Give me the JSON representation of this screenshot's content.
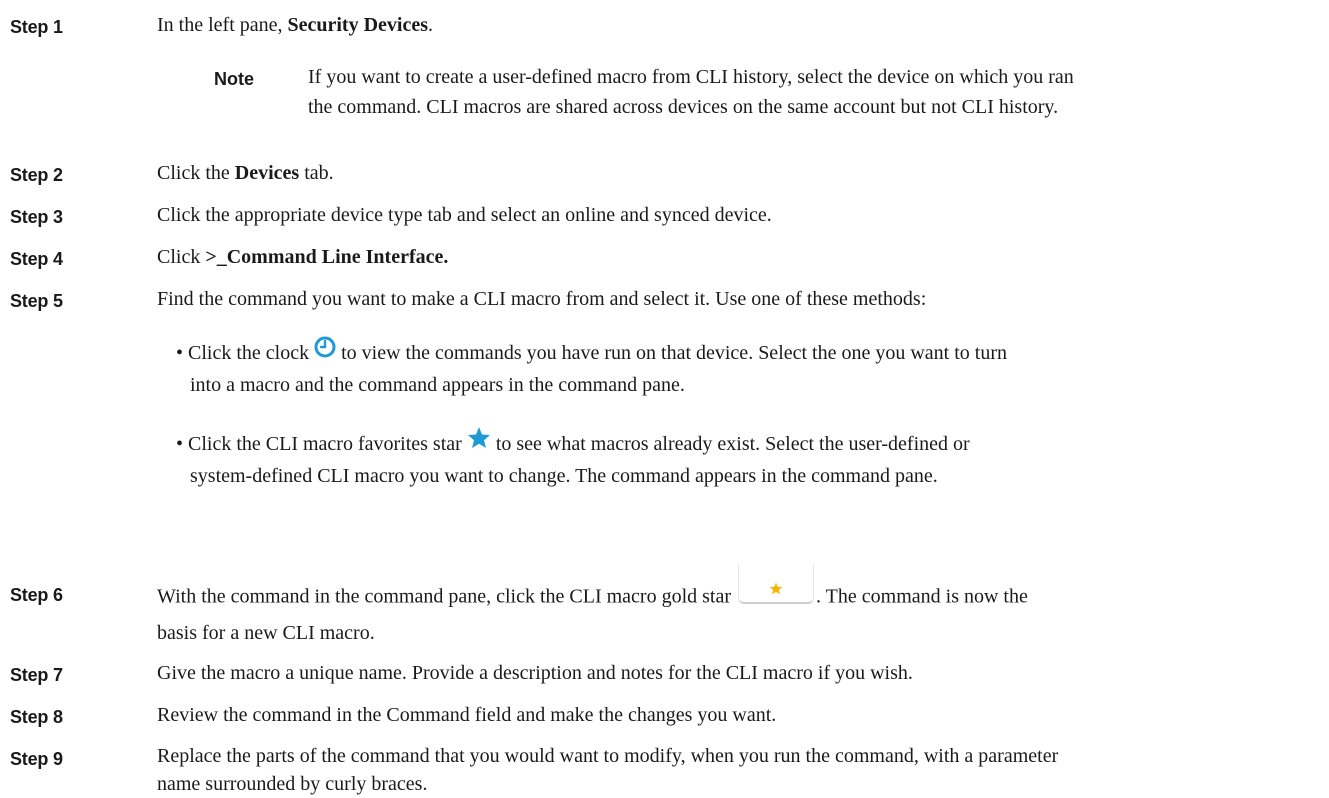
{
  "steps": [
    {
      "label": "Step 1",
      "text_before": "In the left pane, ",
      "bold": "Security Devices",
      "text_after": "."
    },
    {
      "label": "Step 2",
      "text_before": "Click the ",
      "bold": "Devices",
      "text_after": " tab."
    },
    {
      "label": "Step 3",
      "text": "Click the appropriate device type tab and select an online and synced device."
    },
    {
      "label": "Step 4",
      "text_before": "Click ",
      "bold": ">_Command Line Interface."
    },
    {
      "label": "Step 5",
      "text": "Find the command you want to make a CLI macro from and select it. Use one of these methods:"
    },
    {
      "label": "Step 6",
      "text_before": "With the command in the command pane, click the CLI macro gold star",
      "text_after": ". The command is now the",
      "text_line2": "basis for a new CLI macro."
    },
    {
      "label": "Step 7",
      "text": "Give the macro a unique name. Provide a description and notes for the CLI macro if you wish."
    },
    {
      "label": "Step 8",
      "text": "Review the command in the Command field and make the changes you want."
    },
    {
      "label": "Step 9",
      "text_line1": "Replace the parts of the command that you would want to modify, when you run the command, with a parameter",
      "text_line2": "name surrounded by curly braces."
    }
  ],
  "note": {
    "label": "Note",
    "line1": "If you want to create a user-defined macro from CLI history, select the device on which you ran",
    "line2": "the command. CLI macros are shared across devices on the same account but not CLI history."
  },
  "bullets": [
    {
      "line1_before": "• Click the clock",
      "line1_after": "to view the commands you have run on that device. Select the one you want to turn",
      "line2": "into a macro and the command appears in the command pane.",
      "icon": "clock-icon"
    },
    {
      "line1_before": "• Click the CLI macro favorites star",
      "line1_after": "to see what macros already exist. Select the user-defined or",
      "line2": "system-defined CLI macro you want to change. The command appears in the command pane.",
      "icon": "star-icon"
    }
  ],
  "colors": {
    "clock_icon": "#1e9bd7",
    "favorites_star": "#1e9bd7",
    "gold_star": "#f5b800"
  }
}
